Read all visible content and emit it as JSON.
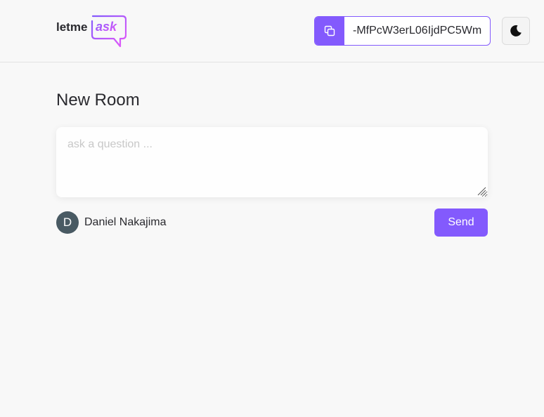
{
  "brand": {
    "logo_text_primary": "letme",
    "logo_text_accent": "ask",
    "accent_color": "#835afd",
    "gradient_start": "#e559f9",
    "gradient_end": "#835afd"
  },
  "header": {
    "room_code": "-MfPcW3erL06IjdPC5Wm",
    "copy_icon": "copy-icon",
    "theme_icon": "moon-icon"
  },
  "main": {
    "title": "New Room",
    "question_placeholder": "ask a question ...",
    "question_value": ""
  },
  "user": {
    "initial": "D",
    "name": "Daniel Nakajima",
    "avatar_color": "#495a63"
  },
  "actions": {
    "send_label": "Send"
  }
}
